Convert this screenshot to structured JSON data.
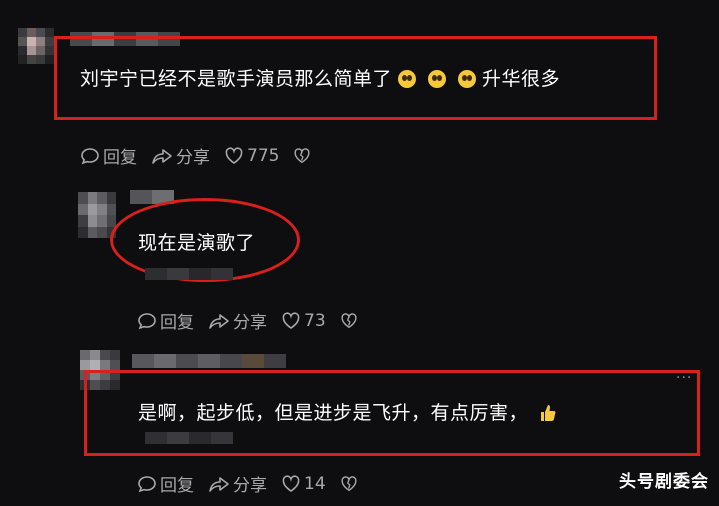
{
  "comments": [
    {
      "text": "刘宇宁已经不是歌手演员那么简单了",
      "suffix": "升华很多",
      "emoji_count": 3,
      "reply_label": "回复",
      "share_label": "分享",
      "likes": "775"
    },
    {
      "text": "现在是演歌了",
      "reply_label": "回复",
      "share_label": "分享",
      "likes": "73"
    },
    {
      "text": "是啊，起步低，但是进步是飞升，有点厉害，",
      "reply_label": "回复",
      "share_label": "分享",
      "likes": "14",
      "more_label": "···"
    }
  ],
  "watermark": "头号剧委会",
  "colors": {
    "background": "#0e0e10",
    "highlight": "#d8201c",
    "action_text": "#a9a9ad"
  },
  "icons": [
    "reply-icon",
    "share-icon",
    "heart-icon",
    "broken-heart-icon",
    "thumbs-up-icon",
    "pleading-face-icon"
  ]
}
